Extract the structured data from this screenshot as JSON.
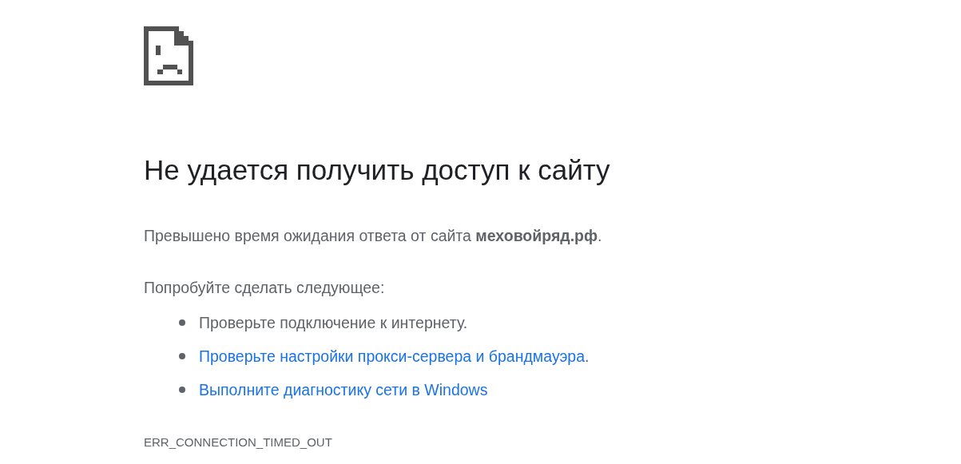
{
  "title": "Не удается получить доступ к сайту",
  "summary": "Превышено время ожидания ответа от сайта **меховойряд.рф**.",
  "suggestions_heading": "Попробуйте сделать следующее:",
  "suggestions": [
    {
      "kind": "text",
      "text": "Проверьте подключение к интернету."
    },
    {
      "kind": "link",
      "text": "Проверьте настройки прокси-сервера и брандмауэра",
      "after": "."
    },
    {
      "kind": "link",
      "text": "Выполните диагностику сети в Windows"
    }
  ],
  "error_code": "ERR_CONNECTION_TIMED_OUT"
}
